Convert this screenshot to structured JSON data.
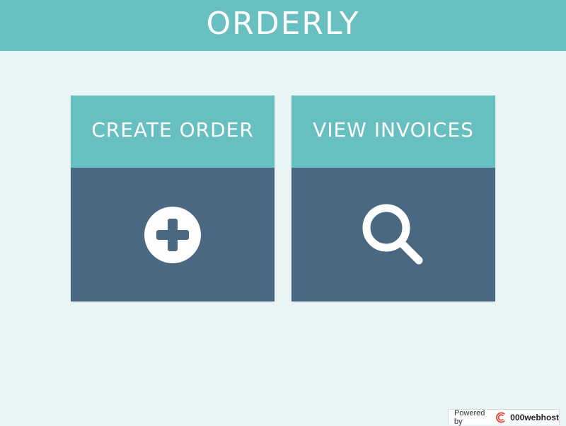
{
  "header": {
    "title": "ORDERLY"
  },
  "cards": [
    {
      "label": "CREATE ORDER",
      "icon": "plus-circle-icon"
    },
    {
      "label": "VIEW INVOICES",
      "icon": "search-icon"
    }
  ],
  "footer": {
    "powered_label": "Powered by",
    "brand": "000webhost"
  },
  "colors": {
    "background": "#eaf5f5",
    "teal": "#67bfbf",
    "slate": "#4b6883",
    "white": "#ffffff"
  }
}
